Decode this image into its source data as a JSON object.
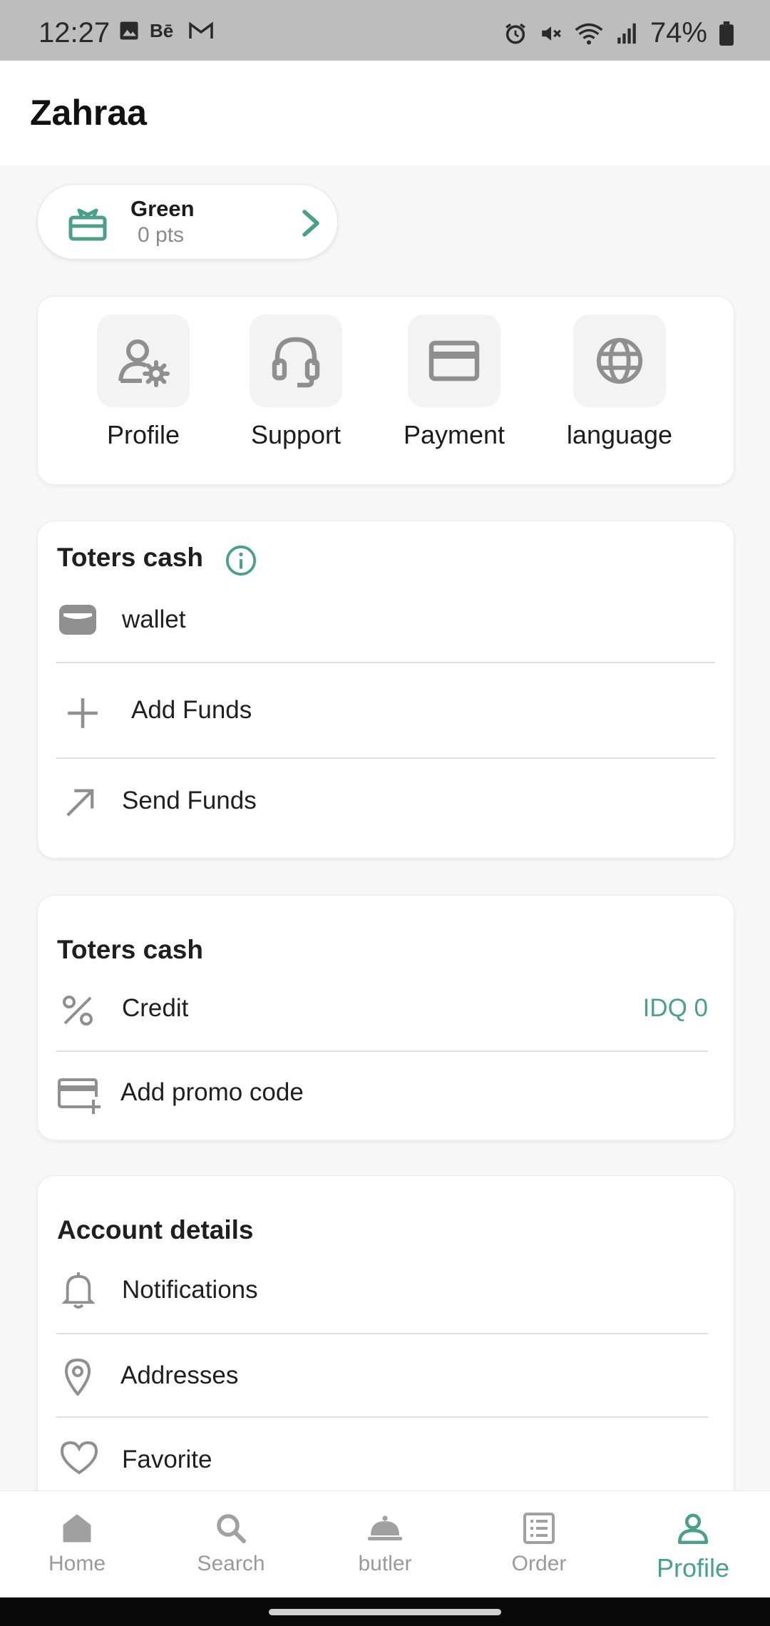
{
  "status_bar": {
    "time": "12:27",
    "battery": "74%"
  },
  "header": {
    "title": "Zahraa"
  },
  "tier": {
    "name": "Green",
    "points": "0 pts"
  },
  "quick_actions": [
    {
      "label": "Profile",
      "icon": "user-gear-icon"
    },
    {
      "label": "Support",
      "icon": "headset-icon"
    },
    {
      "label": "Payment",
      "icon": "credit-card-icon"
    },
    {
      "label": "language",
      "icon": "globe-icon"
    }
  ],
  "cash_section": {
    "title": "Toters cash",
    "rows": [
      {
        "label": "wallet",
        "icon": "wallet-icon"
      },
      {
        "label": "Add Funds",
        "icon": "plus-icon"
      },
      {
        "label": "Send Funds",
        "icon": "arrow-up-right-icon"
      }
    ]
  },
  "credit_section": {
    "title": "Toters cash",
    "credit_label": "Credit",
    "credit_value": "IDQ 0",
    "promo_label": "Add promo code"
  },
  "account_section": {
    "title": "Account details",
    "rows": [
      {
        "label": "Notifications",
        "icon": "bell-icon"
      },
      {
        "label": "Addresses",
        "icon": "location-pin-icon"
      },
      {
        "label": "Favorite",
        "icon": "heart-icon"
      }
    ]
  },
  "bottom_nav": [
    {
      "label": "Home",
      "icon": "home-icon"
    },
    {
      "label": "Search",
      "icon": "search-icon"
    },
    {
      "label": "butler",
      "icon": "butler-bell-icon"
    },
    {
      "label": "Order",
      "icon": "order-list-icon"
    },
    {
      "label": "Profile",
      "icon": "profile-icon",
      "active": true
    }
  ],
  "colors": {
    "accent": "#4aa08a",
    "icon_gray": "#8f8f8f"
  }
}
